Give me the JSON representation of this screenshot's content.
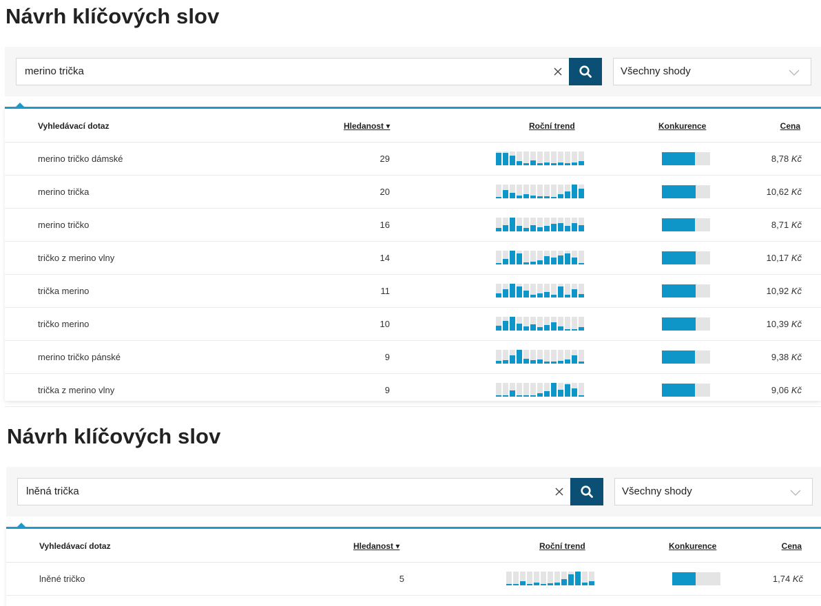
{
  "panels": [
    {
      "title": "Návrh klíčových slov",
      "search_value": "merino trička",
      "match_type": "Všechny shody",
      "headers": {
        "query": "Vyhledávací dotaz",
        "volume": "Hledanost ▾",
        "trend": "Roční trend",
        "competition": "Konkurence",
        "price": "Cena"
      },
      "rows": [
        {
          "query": "merino tričko dámské",
          "volume": "29",
          "price": "8,78",
          "currency": "Kč",
          "competition": 0.68,
          "trend": [
            0.9,
            0.9,
            0.7,
            0.3,
            0.15,
            0.35,
            0.15,
            0.2,
            0.15,
            0.2,
            0.15,
            0.2,
            0.3
          ]
        },
        {
          "query": "merino trička",
          "volume": "20",
          "price": "10,62",
          "currency": "Kč",
          "competition": 0.7,
          "trend": [
            0.1,
            0.6,
            0.4,
            0.2,
            0.3,
            0.2,
            0.15,
            0.15,
            0.1,
            0.3,
            0.5,
            1.0,
            0.7
          ]
        },
        {
          "query": "merino tričko",
          "volume": "16",
          "price": "8,71",
          "currency": "Kč",
          "competition": 0.68,
          "trend": [
            0.25,
            0.45,
            1.0,
            0.4,
            0.25,
            0.45,
            0.3,
            0.4,
            0.55,
            0.6,
            0.4,
            0.6,
            0.45
          ]
        },
        {
          "query": "tričko z merino vlny",
          "volume": "14",
          "price": "10,17",
          "currency": "Kč",
          "competition": 0.7,
          "trend": [
            0.1,
            0.4,
            1.0,
            0.8,
            0.15,
            0.2,
            0.3,
            0.6,
            0.5,
            0.65,
            0.8,
            0.5,
            0.1
          ]
        },
        {
          "query": "trička merino",
          "volume": "11",
          "price": "10,92",
          "currency": "Kč",
          "competition": 0.7,
          "trend": [
            0.3,
            0.6,
            1.0,
            0.8,
            0.5,
            0.2,
            0.3,
            0.4,
            0.2,
            0.8,
            0.2,
            0.6,
            0.25
          ]
        },
        {
          "query": "tričko merino",
          "volume": "10",
          "price": "10,39",
          "currency": "Kč",
          "competition": 0.7,
          "trend": [
            0.35,
            0.7,
            1.0,
            0.5,
            0.3,
            0.45,
            0.25,
            0.4,
            0.6,
            0.3,
            0.1,
            0.1,
            0.25
          ]
        },
        {
          "query": "merino tričko pánské",
          "volume": "9",
          "price": "9,38",
          "currency": "Kč",
          "competition": 0.68,
          "trend": [
            0.2,
            0.25,
            0.6,
            1.0,
            0.35,
            0.25,
            0.3,
            0.15,
            0.15,
            0.2,
            0.3,
            0.6,
            0.15
          ]
        },
        {
          "query": "trička z merino vlny",
          "volume": "9",
          "price": "9,06",
          "currency": "Kč",
          "competition": 0.68,
          "trend": [
            0.1,
            0.1,
            0.45,
            0.1,
            0.1,
            0.1,
            0.25,
            0.4,
            1.0,
            0.5,
            0.9,
            0.6,
            0.1
          ]
        }
      ]
    },
    {
      "title": "Návrh klíčových slov",
      "search_value": "lněná trička",
      "match_type": "Všechny shody",
      "headers": {
        "query": "Vyhledávací dotaz",
        "volume": "Hledanost ▾",
        "trend": "Roční trend",
        "competition": "Konkurence",
        "price": "Cena"
      },
      "rows": [
        {
          "query": "lněné tričko",
          "volume": "5",
          "price": "1,74",
          "currency": "Kč",
          "competition": 0.48,
          "trend": [
            0.1,
            0.1,
            0.3,
            0.1,
            0.2,
            0.1,
            0.15,
            0.2,
            0.45,
            0.8,
            1.0,
            0.2,
            0.3
          ]
        }
      ]
    }
  ],
  "colors": {
    "accent": "#1d9ac9",
    "bar": "#0f96c8",
    "bar_bg": "#e4e4e4",
    "search_button": "#0b5074"
  },
  "icons": {
    "search": "magnifier-icon",
    "clear": "close-icon",
    "select": "chevron-down-icon"
  }
}
